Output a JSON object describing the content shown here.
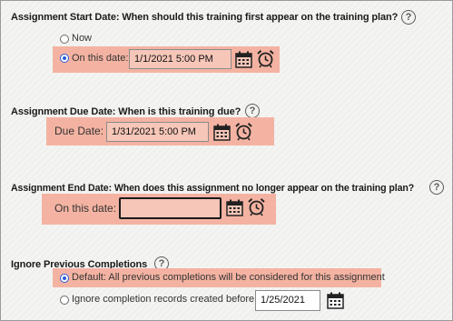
{
  "help_glyph": "?",
  "start": {
    "question": "Assignment Start Date: When should this training first appear on the training plan?",
    "opt_now": "Now",
    "opt_date": "On this date:",
    "date_value": "1/1/2021 5:00 PM",
    "selected": "opt_date"
  },
  "due": {
    "question": "Assignment Due Date: When is this training due?",
    "label": "Due Date:",
    "date_value": "1/31/2021 5:00 PM"
  },
  "end": {
    "question": "Assignment End Date: When does this assignment no longer appear on the training plan?",
    "label": "On this date:",
    "date_value": ""
  },
  "ignore": {
    "question": "Ignore Previous Completions",
    "opt_default": "Default: All previous completions will be considered for this assignment",
    "opt_before": "Ignore completion records created before",
    "date_value": "1/25/2021",
    "selected": "opt_default"
  },
  "icons": [
    "help-icon",
    "calendar-icon",
    "alarm-clock-icon"
  ],
  "colors": {
    "highlight": "#f4b3a2",
    "radio_selected": "#2a5bd7"
  }
}
